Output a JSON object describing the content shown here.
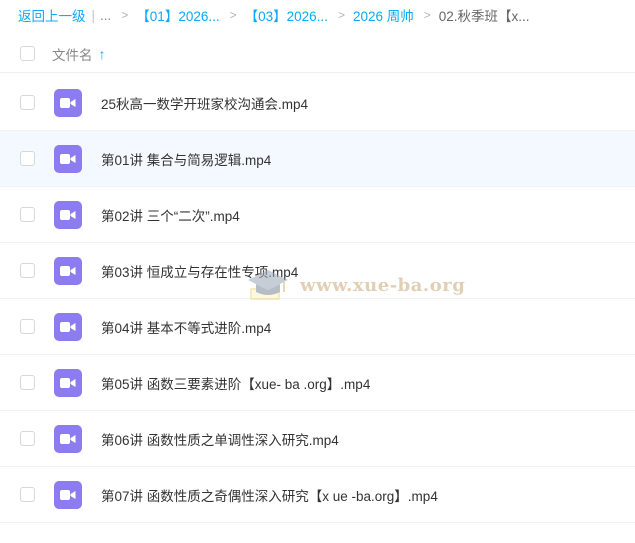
{
  "breadcrumb": {
    "back": "返回上一级",
    "separator": "|",
    "ellipsis": "...",
    "arrow": ">",
    "items": [
      {
        "label": "【01】2026..."
      },
      {
        "label": "【03】2026..."
      },
      {
        "label": "2026 周帅"
      }
    ],
    "current": "02.秋季班【x..."
  },
  "header": {
    "column_name": "文件名",
    "sort_indicator": "↑"
  },
  "files": [
    {
      "name": "25秋高一数学开班家校沟通会.mp4",
      "icon": "video-icon"
    },
    {
      "name": "第01讲 集合与简易逻辑.mp4",
      "icon": "video-icon"
    },
    {
      "name": "第02讲 三个“二次”.mp4",
      "icon": "video-icon"
    },
    {
      "name": "第03讲 恒成立与存在性专项.mp4",
      "icon": "video-icon"
    },
    {
      "name": "第04讲 基本不等式进阶.mp4",
      "icon": "video-icon"
    },
    {
      "name": "第05讲 函数三要素进阶【xue- ba .org】.mp4",
      "icon": "video-icon"
    },
    {
      "name": "第06讲 函数性质之单调性深入研究.mp4",
      "icon": "video-icon"
    },
    {
      "name": "第07讲 函数性质之奇偶性深入研究【x ue -ba.org】.mp4",
      "icon": "video-icon"
    }
  ],
  "watermark": {
    "text": "www.xue-ba.org"
  },
  "colors": {
    "link": "#09aaff",
    "file_icon": "#8c7cf0",
    "hover_row": "#f4f9ff"
  }
}
